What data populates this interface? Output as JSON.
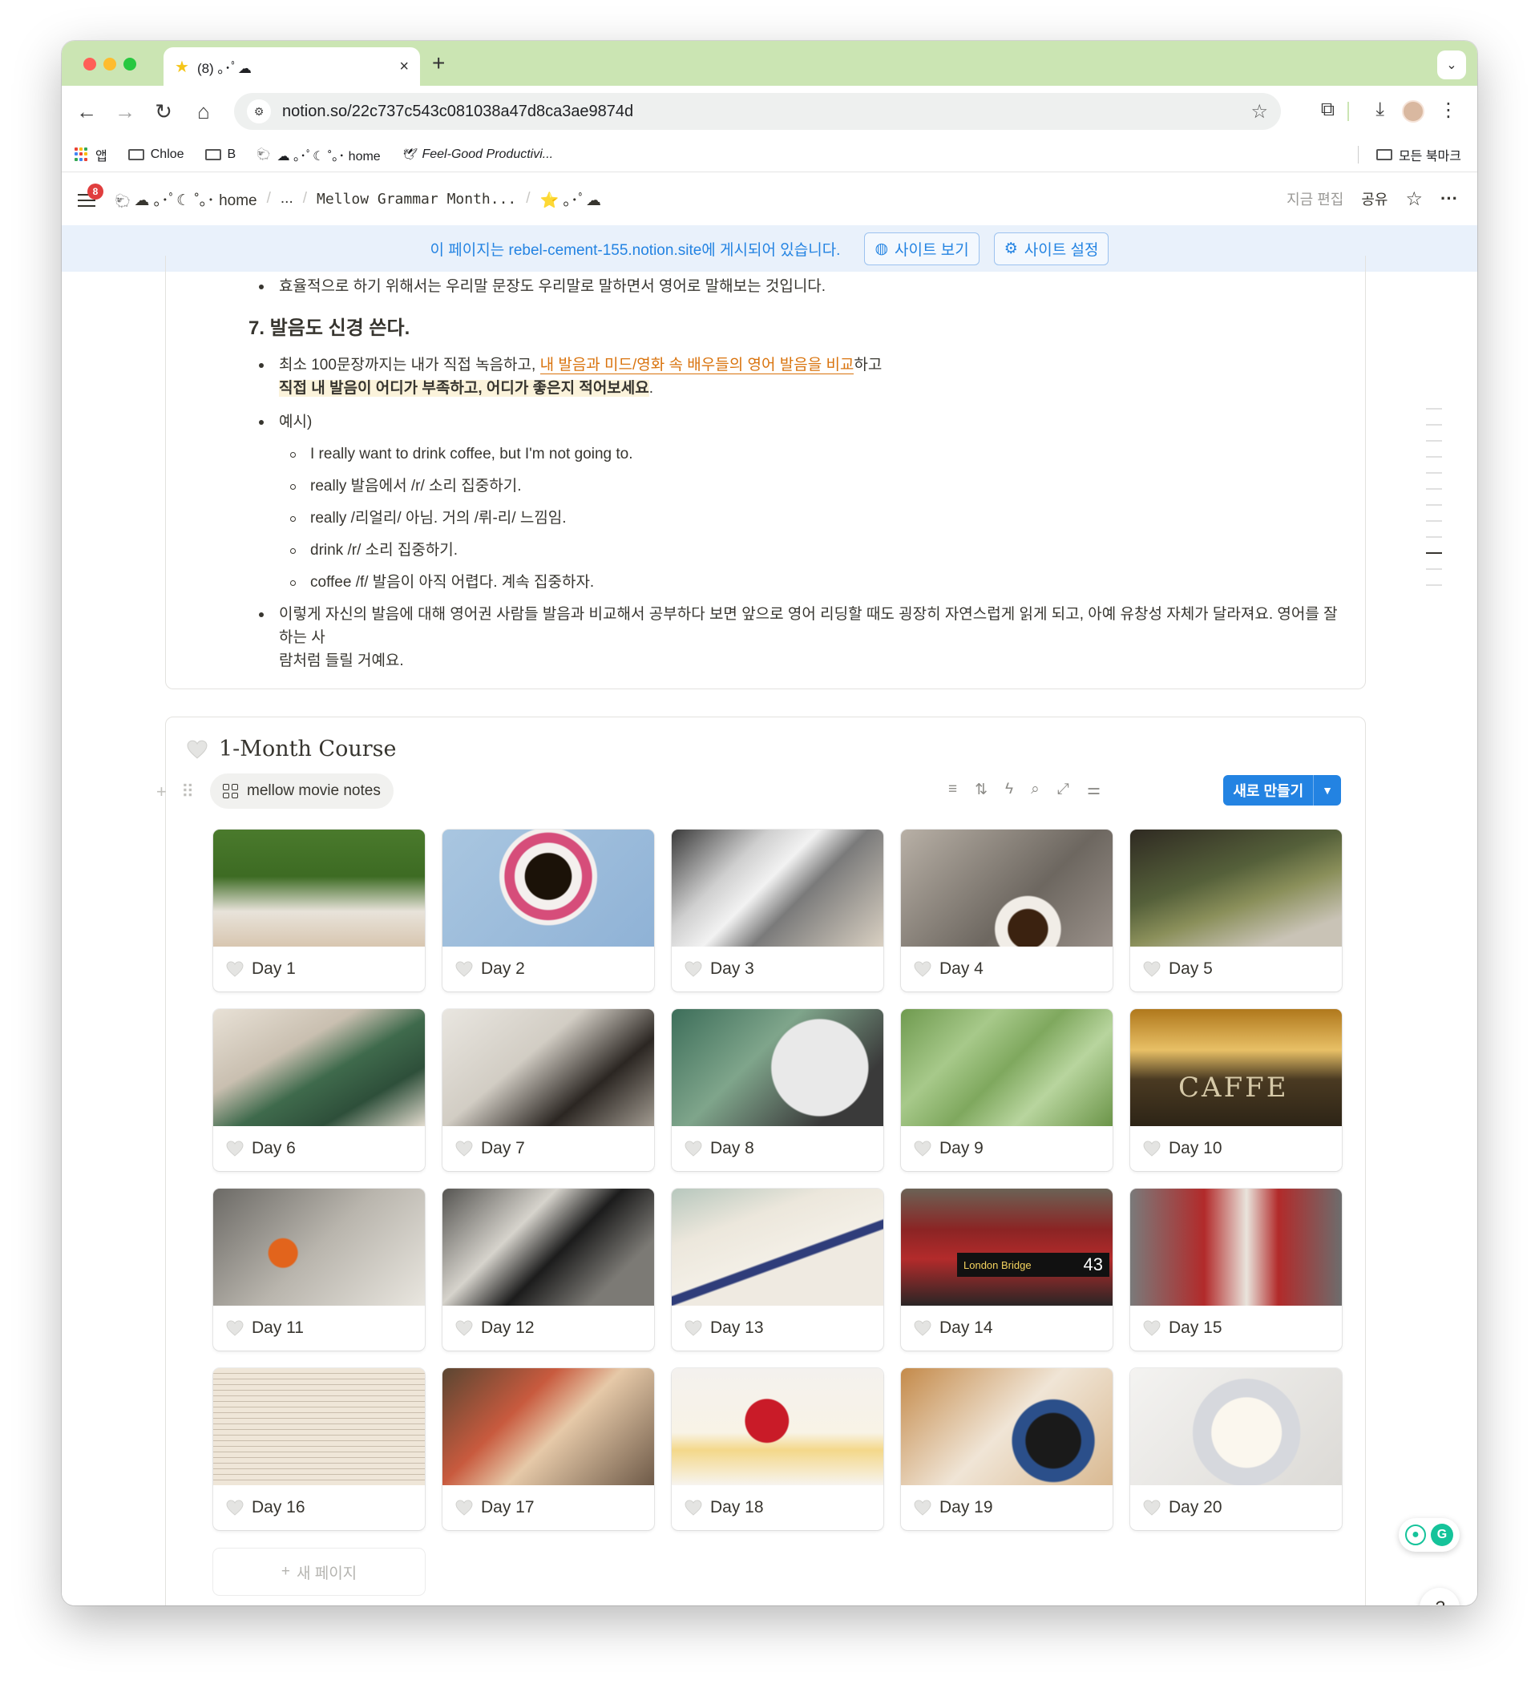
{
  "browser": {
    "tab_title": "(8) ｡･ﾟ☁",
    "tab_icon": "star-emoji",
    "url": "notion.so/22c737c543c081038a47d8ca3ae9874d"
  },
  "bookmarks": {
    "apps": "앱",
    "items": [
      "Chloe",
      "B",
      "☁ ｡･ﾟ☾ ˚｡･ home",
      "Feel-Good Productivi..."
    ],
    "all_bookmarks": "모든 북마크"
  },
  "notion_header": {
    "notification_count": "8",
    "breadcrumb_home": "☁ ｡･ﾟ☾ ˚｡･ home",
    "breadcrumb_ellipsis": "...",
    "breadcrumb_page": "Mellow Grammar Month...",
    "breadcrumb_current": "⭐ ｡･ﾟ☁",
    "edited": "지금 편집",
    "share": "공유",
    "more": "···"
  },
  "banner": {
    "text": "이 페이지는 rebel-cement-155.notion.site에 게시되어 있습니다.",
    "view_site": "사이트 보기",
    "site_settings": "사이트 설정"
  },
  "article": {
    "top_bullet": "효율적으로 하기 위해서는 우리말 문장도 우리말로 말하면서 영어로 말해보는 것입니다.",
    "heading": "7. 발음도 신경 쓴다.",
    "b1_pre": "최소 100문장까지는 내가 직접 녹음하고, ",
    "b1_link": "내 발음과 미드/영화 속 배우들의 영어 발음을 비교",
    "b1_post": "하고",
    "b1_line2": "직접 내 발음이 어디가 부족하고, 어디가 좋은지 적어보세요",
    "b1_line2_end": ".",
    "b2": "예시)",
    "sub": [
      "I really want to drink coffee, but I'm not going to.",
      "really 발음에서 /r/ 소리 집중하기.",
      "really /리얼리/ 아님. 거의 /뤼-리/ 느낌임.",
      "drink /r/ 소리 집중하기.",
      "coffee /f/ 발음이 아직 어렵다. 계속 집중하자."
    ],
    "b3_line1": "이렇게 자신의 발음에 대해 영어권 사람들 발음과 비교해서 공부하다 보면 앞으로 영어 리딩할 때도 굉장히 자연스럽게 읽게 되고, 아예 유창성 자체가 달라져요. 영어를 잘하는 사",
    "b3_line2": "람처럼 들릴 거예요."
  },
  "database": {
    "title": "1-Month Course",
    "view_name": "mellow movie notes",
    "new_button": "새로 만들기",
    "new_page": "새 페이지",
    "cards": [
      {
        "label": "Day 1",
        "photo": "blue-socks-book-on-grass"
      },
      {
        "label": "Day 2",
        "photo": "striped-coffee-cup"
      },
      {
        "label": "Day 3",
        "photo": "cafe-table-camera"
      },
      {
        "label": "Day 4",
        "photo": "magazine-portrait-espresso"
      },
      {
        "label": "Day 5",
        "photo": "film-camera-sunglasses"
      },
      {
        "label": "Day 6",
        "photo": "wisdom-of-insecurity-book"
      },
      {
        "label": "Day 7",
        "photo": "writing-journal-coffee"
      },
      {
        "label": "Day 8",
        "photo": "green-scarf-book-table"
      },
      {
        "label": "Day 9",
        "photo": "green-matcha-texture"
      },
      {
        "label": "Day 10",
        "photo": "caffe-sign"
      },
      {
        "label": "Day 11",
        "photo": "orange-and-book"
      },
      {
        "label": "Day 12",
        "photo": "black-shoes-coffee-cup"
      },
      {
        "label": "Day 13",
        "photo": "bayer-magazine"
      },
      {
        "label": "Day 14",
        "photo": "london-bridge-bus-43"
      },
      {
        "label": "Day 15",
        "photo": "snoopy-fire-hydrant"
      },
      {
        "label": "Day 16",
        "photo": "highlighted-book-page"
      },
      {
        "label": "Day 17",
        "photo": "magazine-and-glass"
      },
      {
        "label": "Day 18",
        "photo": "strawberry-cake"
      },
      {
        "label": "Day 19",
        "photo": "puppy-and-coffee"
      },
      {
        "label": "Day 20",
        "photo": "strawberry-cheesecake"
      }
    ]
  },
  "bus_sign": {
    "route": "London Bridge",
    "number": "43"
  },
  "cafe_sign": "CAFFE",
  "colors": {
    "tab_strip": "#cbe5b3",
    "notion_blue": "#2383e2",
    "banner_bg": "#e9f1fb",
    "highlight_orange": "#d9730d",
    "highlight_yellow_bg": "#fbf3db"
  }
}
